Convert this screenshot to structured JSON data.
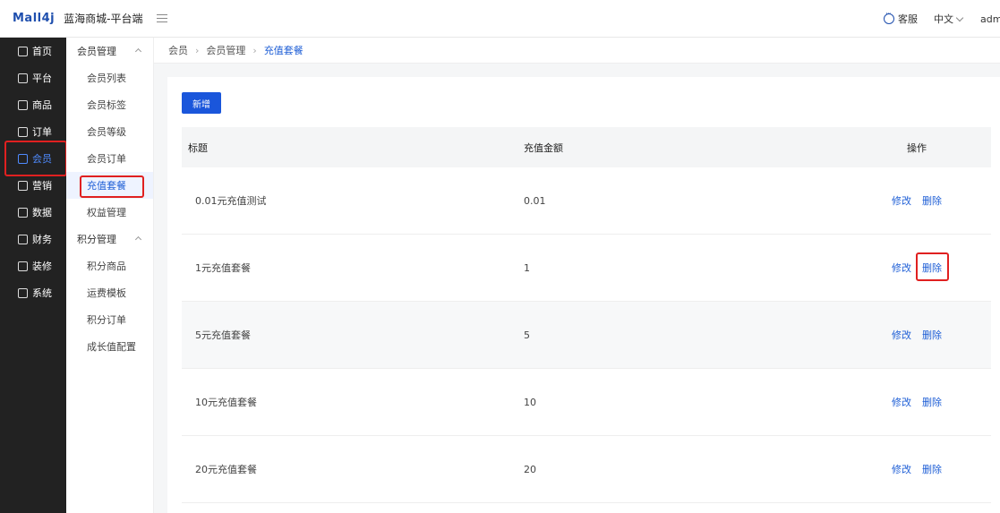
{
  "header": {
    "logo": "Mall4j",
    "title": "蓝海商城-平台端",
    "service_label": "客服",
    "language": "中文",
    "user": "admin"
  },
  "sidebar": {
    "items": [
      {
        "label": "首页",
        "icon": "home-icon"
      },
      {
        "label": "平台",
        "icon": "monitor-icon"
      },
      {
        "label": "商品",
        "icon": "bag-icon"
      },
      {
        "label": "订单",
        "icon": "document-icon"
      },
      {
        "label": "会员",
        "icon": "users-icon"
      },
      {
        "label": "营销",
        "icon": "gift-icon"
      },
      {
        "label": "数据",
        "icon": "chart-icon"
      },
      {
        "label": "财务",
        "icon": "wallet-icon"
      },
      {
        "label": "装修",
        "icon": "brush-icon"
      },
      {
        "label": "系统",
        "icon": "gear-icon"
      }
    ]
  },
  "submenu": {
    "group1": "会员管理",
    "group1_items": [
      "会员列表",
      "会员标签",
      "会员等级",
      "会员订单",
      "充值套餐",
      "权益管理"
    ],
    "group2": "积分管理",
    "group2_items": [
      "积分商品",
      "运费模板",
      "积分订单",
      "成长值配置"
    ]
  },
  "breadcrumb": [
    "会员",
    "会员管理",
    "充值套餐"
  ],
  "toolbar": {
    "add_label": "新增"
  },
  "table": {
    "headers": {
      "title": "标题",
      "amount": "充值金额",
      "ops": "操作"
    },
    "edit_label": "修改",
    "delete_label": "删除",
    "rows": [
      {
        "title": "0.01元充值测试",
        "amount": "0.01"
      },
      {
        "title": "1元充值套餐",
        "amount": "1"
      },
      {
        "title": "5元充值套餐",
        "amount": "5"
      },
      {
        "title": "10元充值套餐",
        "amount": "10"
      },
      {
        "title": "20元充值套餐",
        "amount": "20"
      }
    ]
  },
  "colors": {
    "accent": "#1a56db",
    "highlight": "#e02020",
    "sidebar": "#222222"
  }
}
